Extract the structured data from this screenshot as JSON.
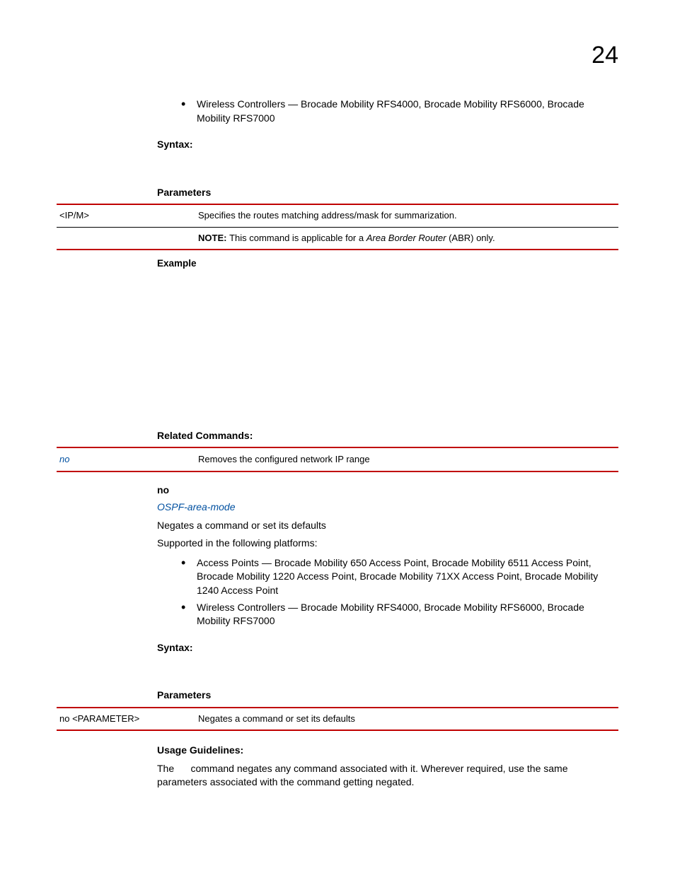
{
  "pageNumber": "24",
  "section1": {
    "bullet1_prefix": "Wireless Controllers — ",
    "bullet1_body": "Brocade Mobility RFS4000, Brocade Mobility RFS6000, Brocade Mobility RFS7000",
    "syntaxHeading": "Syntax:",
    "parametersHeading": "Parameters",
    "param_col1": "<IP/M>",
    "param_row1": "Specifies the routes matching address/mask for summarization.",
    "note_prefix": "NOTE:  ",
    "note_body_pre": "This command is applicable for a ",
    "note_body_italic": "Area Border Router",
    "note_body_post": " (ABR) only.",
    "exampleHeading": "Example",
    "relatedHeading": "Related Commands:",
    "related_col1": "no",
    "related_row1": "Removes the configured network IP range"
  },
  "section2": {
    "heading": "no",
    "link": "OSPF-area-mode",
    "desc": "Negates a command or set its defaults",
    "supported": "Supported in the following platforms:",
    "bullet1_prefix": "Access Points — ",
    "bullet1_body": "Brocade Mobility 650 Access Point, Brocade Mobility 6511 Access Point, Brocade Mobility 1220 Access Point, Brocade Mobility 71XX Access Point, Brocade Mobility 1240 Access Point",
    "bullet2_prefix": "Wireless Controllers — ",
    "bullet2_body": "Brocade Mobility RFS4000, Brocade Mobility RFS6000, Brocade Mobility RFS7000",
    "syntaxHeading": "Syntax:",
    "parametersHeading": "Parameters",
    "param_col1": "no <PARAMETER>",
    "param_row1": "Negates a command or set its defaults",
    "usageHeading": "Usage Guidelines:",
    "usage_pre": "The ",
    "usage_post": " command negates any command associated with it. Wherever required, use the same parameters associated with the command getting negated."
  }
}
